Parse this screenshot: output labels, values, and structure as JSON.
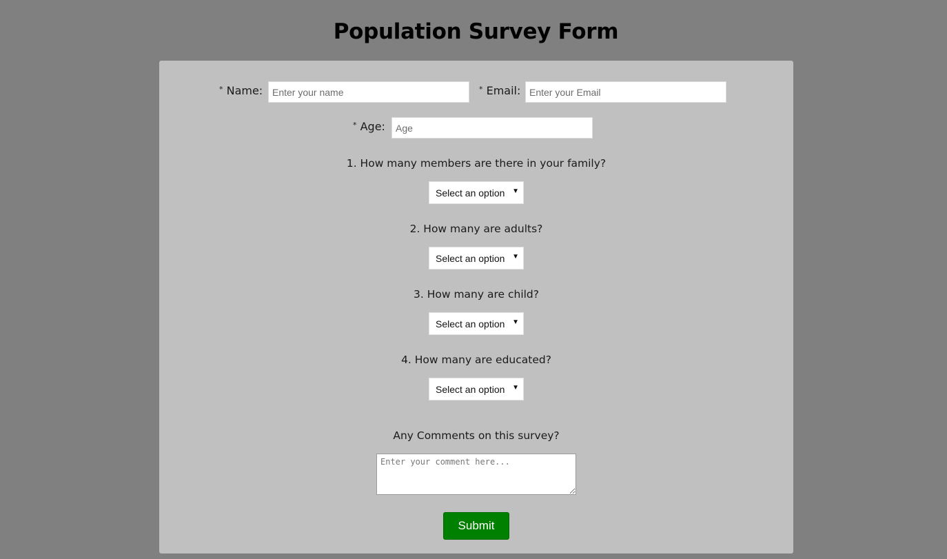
{
  "title": "Population Survey Form",
  "form": {
    "required_marker": "*",
    "name": {
      "label": "Name:",
      "placeholder": "Enter your name",
      "value": ""
    },
    "email": {
      "label": "Email:",
      "placeholder": "Enter your Email",
      "value": ""
    },
    "age": {
      "label": "Age:",
      "placeholder": "Age",
      "value": ""
    },
    "questions": [
      {
        "text": "1. How many members are there in your family?",
        "selected": "Select an option"
      },
      {
        "text": "2. How many are adults?",
        "selected": "Select an option"
      },
      {
        "text": "3. How many are child?",
        "selected": "Select an option"
      },
      {
        "text": "4. How many are educated?",
        "selected": "Select an option"
      }
    ],
    "comments": {
      "label": "Any Comments on this survey?",
      "placeholder": "Enter your comment here...",
      "value": ""
    },
    "submit_label": "Submit"
  },
  "icons": {
    "select_caret": "▼"
  },
  "colors": {
    "page_background": "#808080",
    "panel_background": "#c0c0c0",
    "submit_background": "#008000",
    "submit_text": "#ffffff"
  }
}
